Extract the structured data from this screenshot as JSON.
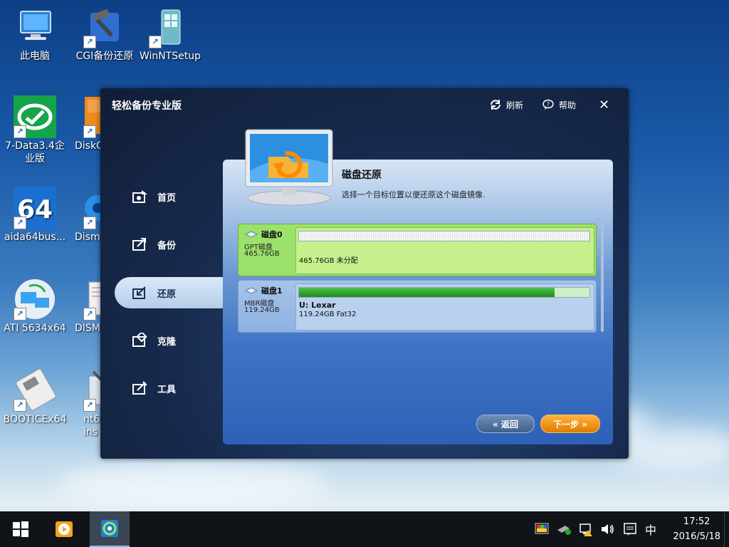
{
  "desktop": {
    "icons": [
      {
        "label": "此电脑",
        "icon": "computer-icon"
      },
      {
        "label": "CGI备份还原",
        "icon": "cgi-backup-icon"
      },
      {
        "label": "WinNTSetup",
        "icon": "winntsetup-icon"
      },
      {
        "label": "7-Data3.4企业版",
        "icon": "7data-recovery-icon"
      },
      {
        "label": "DiskG",
        "icon": "diskgenius-icon"
      },
      {
        "label": "aida64bus...",
        "icon": "aida64-icon"
      },
      {
        "label": "Dism",
        "icon": "dism-icon"
      },
      {
        "label": "ATI 5634x64",
        "icon": "ati-network-icon"
      },
      {
        "label": "DISM",
        "icon": "dism-doc-icon"
      },
      {
        "label": "BOOTICEx64",
        "icon": "bootice-floppy-icon"
      },
      {
        "label": "nt6 ins",
        "icon": "nt6-installer-icon"
      }
    ]
  },
  "window": {
    "title": "轻松备份专业版",
    "refresh_label": "刷新",
    "help_label": "帮助",
    "close_glyph": "✕",
    "nav": [
      {
        "label": "首页",
        "icon": "home-icon"
      },
      {
        "label": "备份",
        "icon": "backup-icon"
      },
      {
        "label": "还原",
        "icon": "restore-icon"
      },
      {
        "label": "克隆",
        "icon": "clone-icon"
      },
      {
        "label": "工具",
        "icon": "tools-icon"
      }
    ],
    "active_nav": "还原",
    "panel": {
      "title": "磁盘还原",
      "subtitle": "选择一个目标位置以便还原这个磁盘镜像.",
      "disks": [
        {
          "name": "磁盘0",
          "type": "GPT磁盘",
          "size": "465.76GB",
          "partition_name": "",
          "partition_info": "465.76GB 未分配",
          "used_fraction": 0,
          "selected": true
        },
        {
          "name": "磁盘1",
          "type": "MBR磁盘",
          "size": "119.24GB",
          "partition_name": "U: Lexar",
          "partition_info": "119.24GB Fat32",
          "used_fraction": 0.88,
          "selected": false
        }
      ],
      "back_label": "« 返回",
      "next_label": "下一步 »"
    }
  },
  "taskbar": {
    "ime": "中",
    "time": "17:52",
    "date": "2016/5/18"
  },
  "colors": {
    "selected_disk": "#9be16b",
    "next_button": "#f29a12",
    "usage_bar": "#2aa52a"
  }
}
